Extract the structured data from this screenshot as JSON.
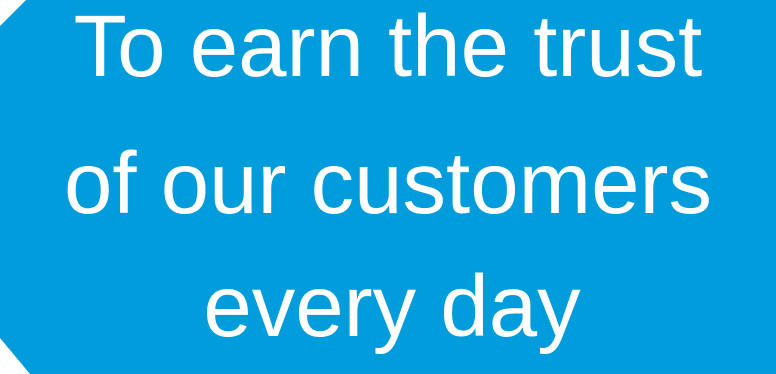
{
  "panel": {
    "color": "#009cdc",
    "lines": [
      "To earn the trust",
      "of our customers",
      "every day"
    ]
  }
}
